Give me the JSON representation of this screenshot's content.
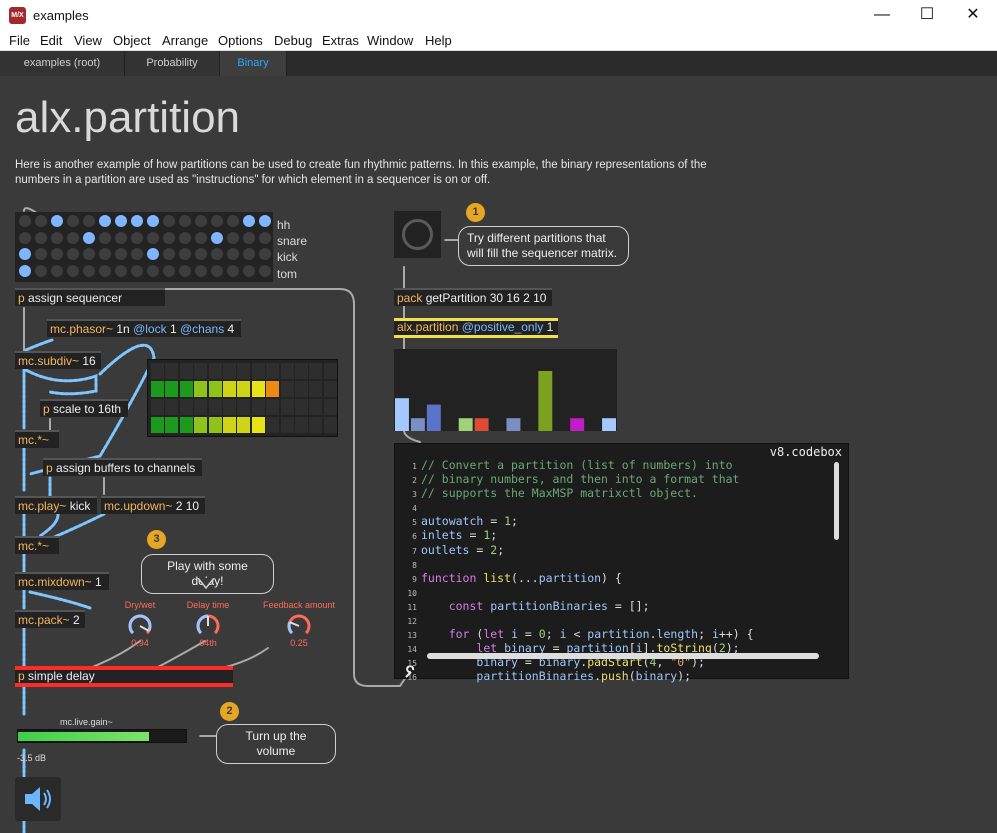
{
  "window": {
    "title": "examples",
    "icon_text": "M/X",
    "minimize": "—",
    "maximize": "☐",
    "close": "✕"
  },
  "menu": [
    "File",
    "Edit",
    "View",
    "Object",
    "Arrange",
    "Options",
    "Debug",
    "Extras",
    "Window",
    "Help"
  ],
  "tabs": [
    {
      "label": "examples (root)",
      "active": false
    },
    {
      "label": "Probability",
      "active": false
    },
    {
      "label": "Binary",
      "active": true
    }
  ],
  "page": {
    "title": "alx.partition",
    "description": "Here is another example of how partitions can be used to create fun rhythmic patterns. In this example, the binary representations of the numbers in a partition are used as \"instructions\" for which element in a sequencer is on or off."
  },
  "sequencer": {
    "rows": [
      {
        "label": "hh",
        "cells": [
          0,
          0,
          1,
          0,
          0,
          1,
          1,
          1,
          1,
          0,
          0,
          0,
          0,
          0,
          1,
          1
        ]
      },
      {
        "label": "snare",
        "cells": [
          0,
          0,
          0,
          0,
          1,
          0,
          0,
          0,
          0,
          0,
          0,
          0,
          1,
          0,
          0,
          0
        ]
      },
      {
        "label": "kick",
        "cells": [
          1,
          0,
          0,
          0,
          0,
          0,
          0,
          0,
          1,
          0,
          0,
          0,
          0,
          0,
          0,
          0
        ]
      },
      {
        "label": "tom",
        "cells": [
          1,
          0,
          0,
          0,
          0,
          0,
          0,
          0,
          0,
          0,
          0,
          0,
          0,
          0,
          0,
          0
        ]
      }
    ]
  },
  "objects": {
    "assign_sequencer": {
      "p": "p",
      "rest": "assign sequencer"
    },
    "phasor": {
      "name": "mc.phasor~",
      "arg": "1n",
      "a1": "@lock",
      "v1": "1",
      "a2": "@chans",
      "v2": "4"
    },
    "subdiv": {
      "name": "mc.subdiv~",
      "arg": "16"
    },
    "scale": {
      "p": "p",
      "rest": "scale to 16th"
    },
    "mul1": {
      "name": "mc.*~"
    },
    "assign_buffers": {
      "p": "p",
      "rest": "assign buffers to channels"
    },
    "play": {
      "name": "mc.play~",
      "arg": "kick"
    },
    "updown": {
      "name": "mc.updown~",
      "arg": "2 10"
    },
    "mul2": {
      "name": "mc.*~"
    },
    "mixdown": {
      "name": "mc.mixdown~",
      "arg": "1"
    },
    "pack": {
      "name": "mc.pack~",
      "arg": "2"
    },
    "simple_delay": {
      "p": "p",
      "rest": "simple delay"
    },
    "get_partition": {
      "name": "pack",
      "rest": "getPartition 30 16 2 10"
    },
    "alx_partition": {
      "name": "alx.partition",
      "attr": "@positive_only",
      "val": "1"
    }
  },
  "meter_cols": [
    {
      "color": "#1d9a1d"
    },
    {
      "color": "#1d9a1d"
    },
    {
      "color": "#1d9a1d"
    },
    {
      "color": "#8fc21a"
    },
    {
      "color": "#8fc21a"
    },
    {
      "color": "#cfd417"
    },
    {
      "color": "#cfd417"
    },
    {
      "color": "#e7e316"
    },
    {
      "color": "#ee8a12"
    },
    {
      "color": "#222222"
    },
    {
      "color": "#222222"
    },
    {
      "color": "#222222"
    },
    {
      "color": "#222222"
    }
  ],
  "meter_pattern": [
    [
      0,
      0,
      0,
      0,
      0,
      0,
      0,
      0,
      0,
      0,
      0,
      0,
      0
    ],
    [
      1,
      1,
      1,
      1,
      1,
      1,
      1,
      1,
      1,
      0,
      0,
      0,
      0
    ],
    [
      0,
      0,
      0,
      0,
      0,
      0,
      0,
      0,
      0,
      0,
      0,
      0,
      0
    ],
    [
      1,
      1,
      1,
      1,
      1,
      1,
      1,
      1,
      0,
      0,
      0,
      0,
      0
    ]
  ],
  "multislider": {
    "values": [
      0.41,
      0.16,
      0.33,
      0,
      0.16,
      0.16,
      0,
      0.16,
      0,
      0.75,
      0,
      0.16,
      0,
      0.16
    ],
    "colors": [
      "#a4c8ff",
      "#7b8fc7",
      "#5a74c9",
      "#2a2a2a",
      "#9ed37a",
      "#e04b36",
      "#2a2a2a",
      "#7b8fc7",
      "#2a2a2a",
      "#7aa11f",
      "#2a2a2a",
      "#c21cc9",
      "#2a2a2a",
      "#a4c8ff"
    ]
  },
  "dials": [
    {
      "label": "Dry/wet",
      "value": "0.94",
      "level": 0.94
    },
    {
      "label": "Delay time",
      "value": "64th",
      "level": 0.5
    },
    {
      "label": "Feedback amount",
      "value": "0.25",
      "level": 0.25
    }
  ],
  "gain": {
    "label": "mc.live.gain~",
    "value": "-3.5 dB",
    "level": 0.78
  },
  "badges": {
    "one": "1",
    "two": "2",
    "three": "3"
  },
  "bubbles": {
    "try": "Try different partitions that will fill the sequencer matrix.",
    "delay": "Play with some delay!",
    "volume": "Turn up the volume"
  },
  "codebox": {
    "title": "v8.codebox",
    "lines": [
      [
        [
          "c-com",
          "// Convert a partition (list of numbers) into"
        ]
      ],
      [
        [
          "c-com",
          "// binary numbers, and then into a format that"
        ]
      ],
      [
        [
          "c-com",
          "// supports the MaxMSP matrixctl object."
        ]
      ],
      [],
      [
        [
          "c-var",
          "autowatch"
        ],
        [
          "c-plain",
          " = "
        ],
        [
          "c-num",
          "1"
        ],
        [
          "c-plain",
          ";"
        ]
      ],
      [
        [
          "c-var",
          "inlets"
        ],
        [
          "c-plain",
          " = "
        ],
        [
          "c-num",
          "1"
        ],
        [
          "c-plain",
          ";"
        ]
      ],
      [
        [
          "c-var",
          "outlets"
        ],
        [
          "c-plain",
          " = "
        ],
        [
          "c-num",
          "2"
        ],
        [
          "c-plain",
          ";"
        ]
      ],
      [],
      [
        [
          "c-kw",
          "function"
        ],
        [
          "c-plain",
          " "
        ],
        [
          "c-fn",
          "list"
        ],
        [
          "c-plain",
          "(..."
        ],
        [
          "c-var",
          "partition"
        ],
        [
          "c-plain",
          ") {"
        ]
      ],
      [],
      [
        [
          "c-plain",
          "    "
        ],
        [
          "c-kw",
          "const"
        ],
        [
          "c-plain",
          " "
        ],
        [
          "c-var",
          "partitionBinaries"
        ],
        [
          "c-plain",
          " = [];"
        ]
      ],
      [],
      [
        [
          "c-plain",
          "    "
        ],
        [
          "c-kw",
          "for"
        ],
        [
          "c-plain",
          " ("
        ],
        [
          "c-kw",
          "let"
        ],
        [
          "c-plain",
          " "
        ],
        [
          "c-var",
          "i"
        ],
        [
          "c-plain",
          " = "
        ],
        [
          "c-num",
          "0"
        ],
        [
          "c-plain",
          "; "
        ],
        [
          "c-var",
          "i"
        ],
        [
          "c-plain",
          " < "
        ],
        [
          "c-var",
          "partition"
        ],
        [
          "c-plain",
          "."
        ],
        [
          "c-var",
          "length"
        ],
        [
          "c-plain",
          "; "
        ],
        [
          "c-var",
          "i"
        ],
        [
          "c-plain",
          "++) {"
        ]
      ],
      [
        [
          "c-plain",
          "        "
        ],
        [
          "c-kw",
          "let"
        ],
        [
          "c-plain",
          " "
        ],
        [
          "c-var",
          "binary"
        ],
        [
          "c-plain",
          " = "
        ],
        [
          "c-var",
          "partition"
        ],
        [
          "c-plain",
          "["
        ],
        [
          "c-var",
          "i"
        ],
        [
          "c-plain",
          "]."
        ],
        [
          "c-fn",
          "toString"
        ],
        [
          "c-plain",
          "("
        ],
        [
          "c-num",
          "2"
        ],
        [
          "c-plain",
          ");"
        ]
      ],
      [
        [
          "c-plain",
          "        "
        ],
        [
          "c-var",
          "binary"
        ],
        [
          "c-plain",
          " = "
        ],
        [
          "c-var",
          "binary"
        ],
        [
          "c-plain",
          "."
        ],
        [
          "c-fn",
          "padStart"
        ],
        [
          "c-plain",
          "("
        ],
        [
          "c-num",
          "4"
        ],
        [
          "c-plain",
          ", "
        ],
        [
          "c-str",
          "\"0\""
        ],
        [
          "c-plain",
          ");"
        ]
      ],
      [
        [
          "c-plain",
          "        "
        ],
        [
          "c-var",
          "partitionBinaries"
        ],
        [
          "c-plain",
          "."
        ],
        [
          "c-fn",
          "push"
        ],
        [
          "c-plain",
          "("
        ],
        [
          "c-var",
          "binary"
        ],
        [
          "c-plain",
          ");"
        ]
      ]
    ]
  }
}
